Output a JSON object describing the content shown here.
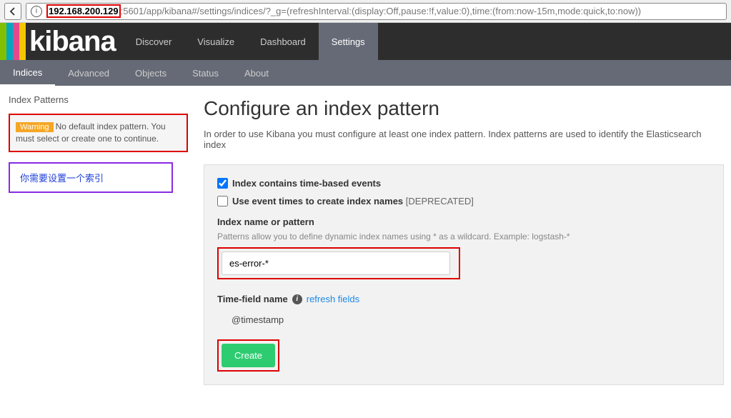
{
  "browser": {
    "url_ip": "192.168.200.129",
    "url_port": ":5601",
    "url_path": "/app/kibana#/settings/indices/?_g=(refreshInterval:(display:Off,pause:!f,value:0),time:(from:now-15m,mode:quick,to:now))"
  },
  "logo": "kibana",
  "nav": {
    "items": [
      "Discover",
      "Visualize",
      "Dashboard",
      "Settings"
    ],
    "active": "Settings"
  },
  "subnav": {
    "items": [
      "Indices",
      "Advanced",
      "Objects",
      "Status",
      "About"
    ],
    "active": "Indices"
  },
  "sidebar": {
    "heading": "Index Patterns",
    "warning_badge": "Warning",
    "warning_text": "No default index pattern. You must select or create one to continue.",
    "annotation": "你需要设置一个索引"
  },
  "main": {
    "title": "Configure an index pattern",
    "desc": "In order to use Kibana you must configure at least one index pattern. Index patterns are used to identify the Elasticsearch index",
    "checkbox1_label": "Index contains time-based events",
    "checkbox2_label": "Use event times to create index names",
    "checkbox2_deprecated": "[DEPRECATED]",
    "index_label": "Index name or pattern",
    "index_hint": "Patterns allow you to define dynamic index names using * as a wildcard. Example: logstash-*",
    "index_value": "es-error-*",
    "timefield_label": "Time-field name",
    "refresh_link": "refresh fields",
    "timefield_value": "@timestamp",
    "create_label": "Create"
  }
}
